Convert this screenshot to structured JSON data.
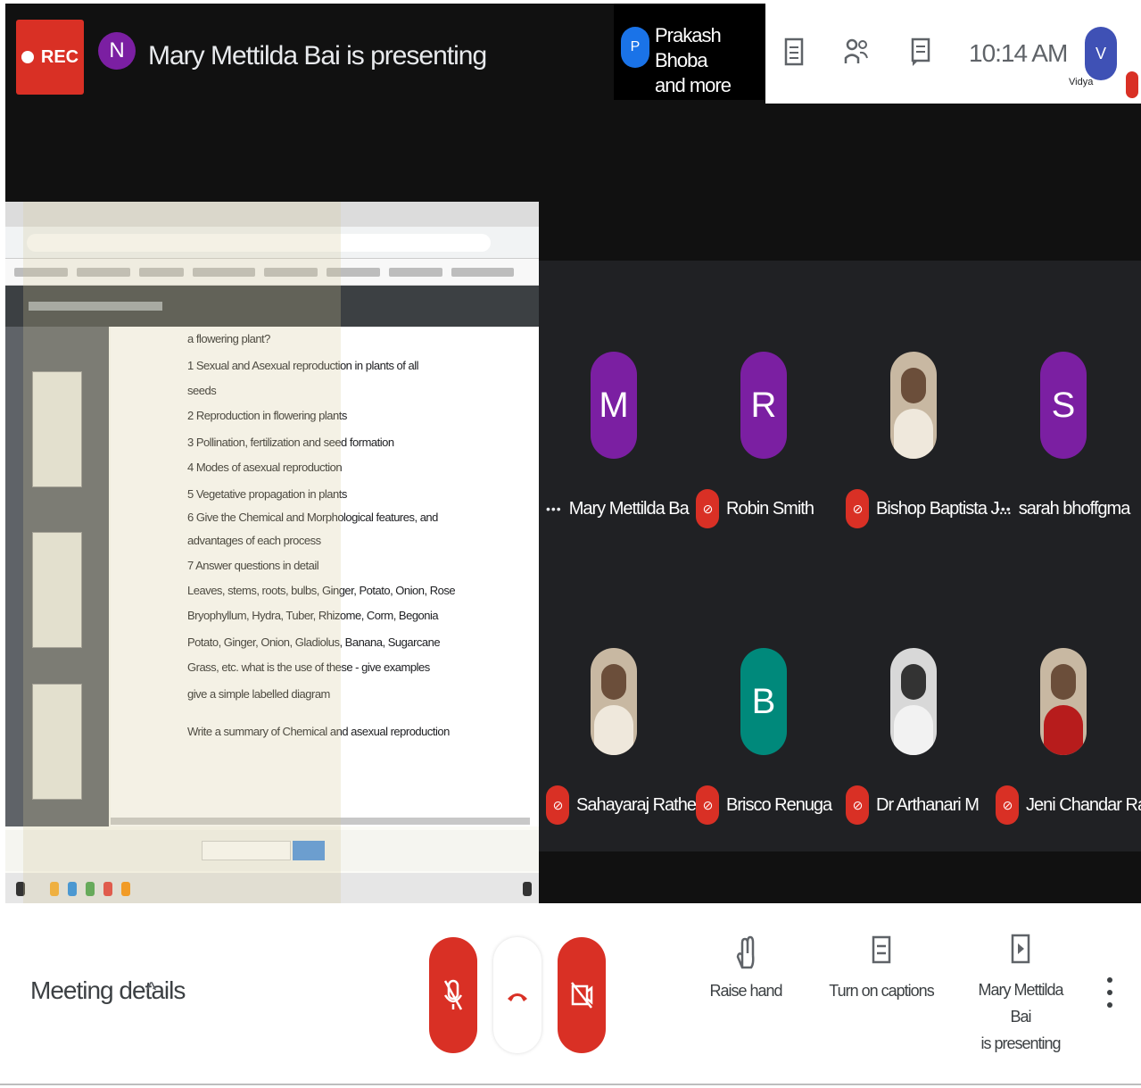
{
  "topbar": {
    "rec_label": "REC",
    "presenter_initial": "N",
    "presenting_text": "Mary Mettilda Bai is presenting",
    "people_initial": "P",
    "people_line1": "Prakash Bhoba",
    "people_line2": "and more",
    "clock": "10:14 AM",
    "self_initial": "V",
    "self_label": "Vidya"
  },
  "participants": [
    {
      "name": "Mary Mettilda Ba",
      "initial": "M",
      "avatar_color": "#7b1fa2",
      "status": "more"
    },
    {
      "name": "Robin Smith",
      "initial": "R",
      "avatar_color": "#7b1fa2",
      "status": "muted"
    },
    {
      "name": "Bishop Baptista J...",
      "initial": "",
      "avatar_color": "",
      "status": "muted",
      "photo": "color"
    },
    {
      "name": "sarah bhoffgma",
      "initial": "S",
      "avatar_color": "#7b1fa2",
      "status": "more"
    },
    {
      "name": "Sahayaraj Rathel...",
      "initial": "",
      "avatar_color": "",
      "status": "muted",
      "photo": "color"
    },
    {
      "name": "Brisco Renuga",
      "initial": "B",
      "avatar_color": "#00897b",
      "status": "muted"
    },
    {
      "name": "Dr Arthanari M",
      "initial": "",
      "avatar_color": "",
      "status": "muted",
      "photo": "bw"
    },
    {
      "name": "Jeni Chandar Ra...",
      "initial": "",
      "avatar_color": "",
      "status": "muted",
      "photo": "red"
    }
  ],
  "document": {
    "lines": [
      "a flowering plant?",
      "1 Sexual and Asexual reproduction in plants of all",
      "seeds",
      "2 Reproduction in flowering plants",
      "3 Pollination, fertilization and seed formation",
      "4 Modes of asexual reproduction",
      "5 Vegetative propagation in plants",
      "6 Give the Chemical and Morphological features, and",
      "advantages of each process",
      "7 Answer questions in detail",
      "Leaves, stems, roots, bulbs, Ginger, Potato, Onion, Rose",
      "Bryophyllum, Hydra, Tuber, Rhizome, Corm, Begonia",
      "Potato, Ginger, Onion, Gladiolus, Banana, Sugarcane",
      "Grass, etc. what is the use of these - give examples",
      "give a simple labelled diagram",
      "Write a summary of Chemical and asexual reproduction"
    ]
  },
  "controls": {
    "meeting_details": "Meeting details",
    "raise_hand": "Raise hand",
    "turn_on_captions": "Turn on captions",
    "presenting_line1": "Mary Mettilda Bai",
    "presenting_line2": "is presenting"
  },
  "icons": {
    "info": "info-icon",
    "people": "people-icon",
    "chat": "chat-icon",
    "activities": "activities-icon",
    "mic_off": "mic-off-icon",
    "leave": "call-end-icon",
    "cam_off": "camera-off-icon",
    "hand": "hand-icon",
    "captions": "captions-icon",
    "present": "present-icon",
    "more": "more-vert-icon"
  },
  "colors": {
    "danger": "#d93025",
    "stage_bg": "#202124",
    "dark_bg": "#111111"
  }
}
